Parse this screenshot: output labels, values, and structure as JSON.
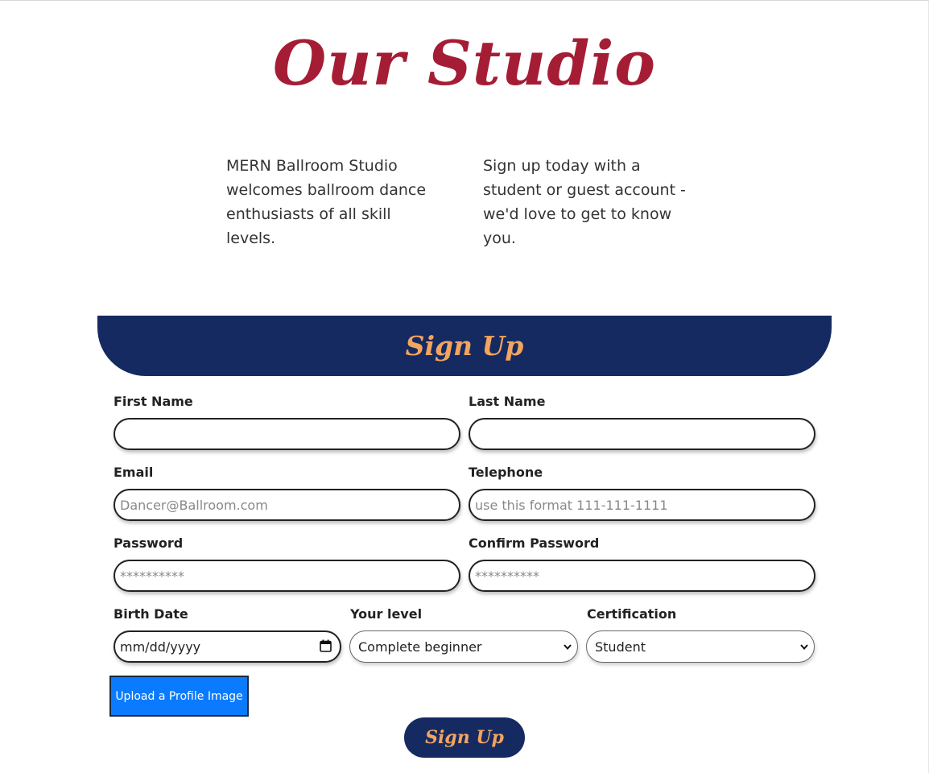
{
  "hero": {
    "title": "Our Studio",
    "intro_left": "MERN Ballroom Studio welcomes ballroom dance enthusiasts of all skill levels.",
    "intro_right": "Sign up today with a student or guest account - we'd love to get to know you."
  },
  "form": {
    "heading": "Sign Up",
    "first_name": {
      "label": "First Name",
      "value": "",
      "placeholder": ""
    },
    "last_name": {
      "label": "Last Name",
      "value": "",
      "placeholder": ""
    },
    "email": {
      "label": "Email",
      "value": "",
      "placeholder": "Dancer@Ballroom.com"
    },
    "telephone": {
      "label": "Telephone",
      "value": "",
      "placeholder": "use this format 111-111-1111"
    },
    "password": {
      "label": "Password",
      "value": "",
      "placeholder": "**********"
    },
    "confirm_password": {
      "label": "Confirm Password",
      "value": "",
      "placeholder": "**********"
    },
    "birth_date": {
      "label": "Birth Date",
      "value": "mm/dd/yyyy",
      "icon": "calendar-icon"
    },
    "level": {
      "label": "Your level",
      "selected": "Complete beginner",
      "icon": "chevron-down-icon"
    },
    "certification": {
      "label": "Certification",
      "selected": "Student",
      "icon": "chevron-down-icon"
    },
    "upload_label": "Upload a Profile Image",
    "submit_label": "Sign Up"
  },
  "colors": {
    "title_red": "#a51d35",
    "navy": "#152a61",
    "accent_orange": "#f3a45f",
    "upload_blue": "#0a7bff"
  }
}
